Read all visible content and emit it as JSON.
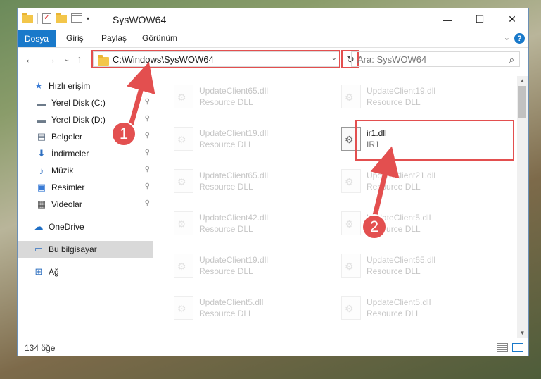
{
  "window": {
    "title": "SysWOW64"
  },
  "controls": {
    "minimize": "—",
    "maximize": "☐",
    "close": "✕"
  },
  "ribbon": {
    "tabs": [
      "Dosya",
      "Giriş",
      "Paylaş",
      "Görünüm"
    ],
    "help": "?",
    "expand_glyph": "⌄"
  },
  "nav": {
    "back": "←",
    "forward": "→",
    "recent": "⌄",
    "up": "↑",
    "address": "C:\\Windows\\SysWOW64",
    "address_drop": "⌄",
    "refresh": "↻",
    "search_placeholder": "Ara: SysWOW64",
    "search_glyph": "⌕"
  },
  "sidebar": {
    "items": [
      {
        "label": "Hızlı erişim",
        "icon": "★",
        "icon_color": "#3a7bd5",
        "pinned": false
      },
      {
        "label": "Yerel Disk (C:)",
        "icon": "▬",
        "icon_color": "#6d7b8a",
        "pinned": true
      },
      {
        "label": "Yerel Disk (D:)",
        "icon": "▬",
        "icon_color": "#6d7b8a",
        "pinned": true
      },
      {
        "label": "Belgeler",
        "icon": "▤",
        "icon_color": "#5c6c80",
        "pinned": true
      },
      {
        "label": "İndirmeler",
        "icon": "⬇",
        "icon_color": "#2e6fc0",
        "pinned": true
      },
      {
        "label": "Müzik",
        "icon": "♪",
        "icon_color": "#2e6fc0",
        "pinned": true
      },
      {
        "label": "Resimler",
        "icon": "▣",
        "icon_color": "#3a7bd5",
        "pinned": true
      },
      {
        "label": "Videolar",
        "icon": "▦",
        "icon_color": "#555555",
        "pinned": true
      },
      {
        "label": "OneDrive",
        "icon": "☁",
        "icon_color": "#1f6fc5",
        "pinned": false
      },
      {
        "label": "Bu bilgisayar",
        "icon": "▭",
        "icon_color": "#2e6fc0",
        "pinned": false,
        "selected": true
      },
      {
        "label": "Ağ",
        "icon": "⊞",
        "icon_color": "#2e6fc0",
        "pinned": false
      }
    ],
    "pin_glyph": "📌"
  },
  "files": [
    {
      "name": "UpdateClient65.dll",
      "desc": "Resource DLL",
      "faded": true
    },
    {
      "name": "UpdateClient19.dll",
      "desc": "Resource DLL",
      "faded": true
    },
    {
      "name": "UpdateClient19.dll",
      "desc": "Resource DLL",
      "faded": true
    },
    {
      "name": "ir1.dll",
      "desc": "IR1",
      "faded": false
    },
    {
      "name": "UpdateClient65.dll",
      "desc": "Resource DLL",
      "faded": true
    },
    {
      "name": "UpdateClient21.dll",
      "desc": "Resource DLL",
      "faded": true
    },
    {
      "name": "UpdateClient42.dll",
      "desc": "Resource DLL",
      "faded": true
    },
    {
      "name": "UpdateClient5.dll",
      "desc": "Resource DLL",
      "faded": true
    },
    {
      "name": "UpdateClient19.dll",
      "desc": "Resource DLL",
      "faded": true
    },
    {
      "name": "UpdateClient65.dll",
      "desc": "Resource DLL",
      "faded": true
    },
    {
      "name": "UpdateClient5.dll",
      "desc": "Resource DLL",
      "faded": true
    },
    {
      "name": "UpdateClient5.dll",
      "desc": "Resource DLL",
      "faded": true
    }
  ],
  "status": {
    "count": "134 öğe"
  },
  "annotations": {
    "step1": "1",
    "step2": "2",
    "color": "#e34f4f"
  },
  "scroll": {
    "up": "▲",
    "down": "▼"
  }
}
